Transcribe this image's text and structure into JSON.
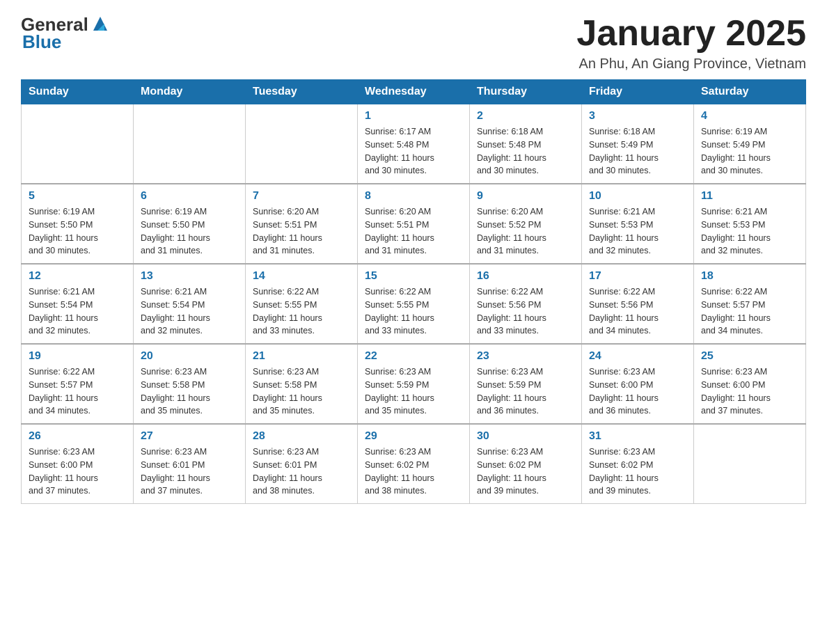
{
  "header": {
    "logo": {
      "text_general": "General",
      "text_blue": "Blue"
    },
    "title": "January 2025",
    "location": "An Phu, An Giang Province, Vietnam"
  },
  "days_of_week": [
    "Sunday",
    "Monday",
    "Tuesday",
    "Wednesday",
    "Thursday",
    "Friday",
    "Saturday"
  ],
  "weeks": [
    {
      "days": [
        {
          "num": "",
          "info": ""
        },
        {
          "num": "",
          "info": ""
        },
        {
          "num": "",
          "info": ""
        },
        {
          "num": "1",
          "info": "Sunrise: 6:17 AM\nSunset: 5:48 PM\nDaylight: 11 hours\nand 30 minutes."
        },
        {
          "num": "2",
          "info": "Sunrise: 6:18 AM\nSunset: 5:48 PM\nDaylight: 11 hours\nand 30 minutes."
        },
        {
          "num": "3",
          "info": "Sunrise: 6:18 AM\nSunset: 5:49 PM\nDaylight: 11 hours\nand 30 minutes."
        },
        {
          "num": "4",
          "info": "Sunrise: 6:19 AM\nSunset: 5:49 PM\nDaylight: 11 hours\nand 30 minutes."
        }
      ]
    },
    {
      "days": [
        {
          "num": "5",
          "info": "Sunrise: 6:19 AM\nSunset: 5:50 PM\nDaylight: 11 hours\nand 30 minutes."
        },
        {
          "num": "6",
          "info": "Sunrise: 6:19 AM\nSunset: 5:50 PM\nDaylight: 11 hours\nand 31 minutes."
        },
        {
          "num": "7",
          "info": "Sunrise: 6:20 AM\nSunset: 5:51 PM\nDaylight: 11 hours\nand 31 minutes."
        },
        {
          "num": "8",
          "info": "Sunrise: 6:20 AM\nSunset: 5:51 PM\nDaylight: 11 hours\nand 31 minutes."
        },
        {
          "num": "9",
          "info": "Sunrise: 6:20 AM\nSunset: 5:52 PM\nDaylight: 11 hours\nand 31 minutes."
        },
        {
          "num": "10",
          "info": "Sunrise: 6:21 AM\nSunset: 5:53 PM\nDaylight: 11 hours\nand 32 minutes."
        },
        {
          "num": "11",
          "info": "Sunrise: 6:21 AM\nSunset: 5:53 PM\nDaylight: 11 hours\nand 32 minutes."
        }
      ]
    },
    {
      "days": [
        {
          "num": "12",
          "info": "Sunrise: 6:21 AM\nSunset: 5:54 PM\nDaylight: 11 hours\nand 32 minutes."
        },
        {
          "num": "13",
          "info": "Sunrise: 6:21 AM\nSunset: 5:54 PM\nDaylight: 11 hours\nand 32 minutes."
        },
        {
          "num": "14",
          "info": "Sunrise: 6:22 AM\nSunset: 5:55 PM\nDaylight: 11 hours\nand 33 minutes."
        },
        {
          "num": "15",
          "info": "Sunrise: 6:22 AM\nSunset: 5:55 PM\nDaylight: 11 hours\nand 33 minutes."
        },
        {
          "num": "16",
          "info": "Sunrise: 6:22 AM\nSunset: 5:56 PM\nDaylight: 11 hours\nand 33 minutes."
        },
        {
          "num": "17",
          "info": "Sunrise: 6:22 AM\nSunset: 5:56 PM\nDaylight: 11 hours\nand 34 minutes."
        },
        {
          "num": "18",
          "info": "Sunrise: 6:22 AM\nSunset: 5:57 PM\nDaylight: 11 hours\nand 34 minutes."
        }
      ]
    },
    {
      "days": [
        {
          "num": "19",
          "info": "Sunrise: 6:22 AM\nSunset: 5:57 PM\nDaylight: 11 hours\nand 34 minutes."
        },
        {
          "num": "20",
          "info": "Sunrise: 6:23 AM\nSunset: 5:58 PM\nDaylight: 11 hours\nand 35 minutes."
        },
        {
          "num": "21",
          "info": "Sunrise: 6:23 AM\nSunset: 5:58 PM\nDaylight: 11 hours\nand 35 minutes."
        },
        {
          "num": "22",
          "info": "Sunrise: 6:23 AM\nSunset: 5:59 PM\nDaylight: 11 hours\nand 35 minutes."
        },
        {
          "num": "23",
          "info": "Sunrise: 6:23 AM\nSunset: 5:59 PM\nDaylight: 11 hours\nand 36 minutes."
        },
        {
          "num": "24",
          "info": "Sunrise: 6:23 AM\nSunset: 6:00 PM\nDaylight: 11 hours\nand 36 minutes."
        },
        {
          "num": "25",
          "info": "Sunrise: 6:23 AM\nSunset: 6:00 PM\nDaylight: 11 hours\nand 37 minutes."
        }
      ]
    },
    {
      "days": [
        {
          "num": "26",
          "info": "Sunrise: 6:23 AM\nSunset: 6:00 PM\nDaylight: 11 hours\nand 37 minutes."
        },
        {
          "num": "27",
          "info": "Sunrise: 6:23 AM\nSunset: 6:01 PM\nDaylight: 11 hours\nand 37 minutes."
        },
        {
          "num": "28",
          "info": "Sunrise: 6:23 AM\nSunset: 6:01 PM\nDaylight: 11 hours\nand 38 minutes."
        },
        {
          "num": "29",
          "info": "Sunrise: 6:23 AM\nSunset: 6:02 PM\nDaylight: 11 hours\nand 38 minutes."
        },
        {
          "num": "30",
          "info": "Sunrise: 6:23 AM\nSunset: 6:02 PM\nDaylight: 11 hours\nand 39 minutes."
        },
        {
          "num": "31",
          "info": "Sunrise: 6:23 AM\nSunset: 6:02 PM\nDaylight: 11 hours\nand 39 minutes."
        },
        {
          "num": "",
          "info": ""
        }
      ]
    }
  ]
}
